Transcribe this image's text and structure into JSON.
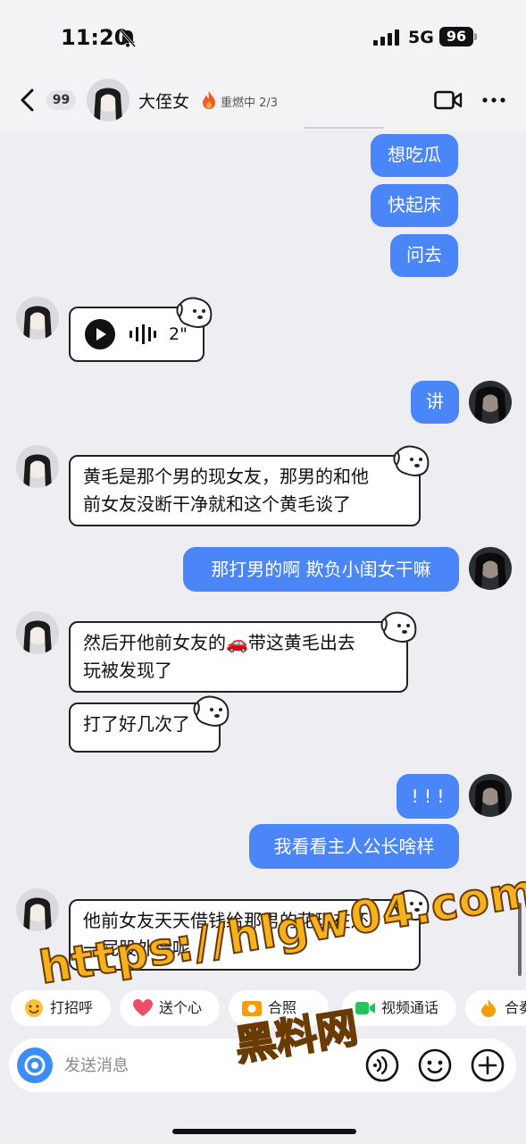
{
  "status_bar": {
    "time": "11:20",
    "network": "5G",
    "battery": "96"
  },
  "header": {
    "unread_count": "99",
    "contact_name": "大侄女",
    "streak_text": "重燃中 2/3"
  },
  "messages": [
    {
      "from": "me",
      "text": "想吃瓜"
    },
    {
      "from": "me",
      "text": "快起床"
    },
    {
      "from": "me",
      "text": "问去"
    },
    {
      "from": "them",
      "type": "voice",
      "duration": "2\""
    },
    {
      "from": "me",
      "text": "讲"
    },
    {
      "from": "them",
      "lines": [
        "黄毛是那个男的现女友，那男的和他",
        "前女友没断干净就和这个黄毛谈了"
      ]
    },
    {
      "from": "me",
      "text": "那打男的啊 欺负小闺女干嘛"
    },
    {
      "from": "them",
      "lines": [
        "然后开他前女友的🚗带这黄毛出去",
        "玩被发现了"
      ]
    },
    {
      "from": "them",
      "text": "打了好几次了"
    },
    {
      "from": "me",
      "text": "! ! !"
    },
    {
      "from": "me",
      "text": "我看看主人公长啥样"
    },
    {
      "from": "them",
      "lines": [
        "他前女友天天借钱给那男的花现在还",
        "一屁股外债呢"
      ]
    }
  ],
  "quick_actions": [
    {
      "label": "打招呼",
      "icon": "smile-emoji-icon"
    },
    {
      "label": "送个心",
      "icon": "heart-icon"
    },
    {
      "label": "合照",
      "icon": "photo-icon"
    },
    {
      "label": "视频通话",
      "icon": "video-call-icon",
      "icon_color": "#22c55e"
    },
    {
      "label": "合奏",
      "icon": "flame-icon"
    }
  ],
  "input": {
    "placeholder": "发送消息"
  },
  "watermark": {
    "url": "https://hlgw04.com",
    "site": "黑料网"
  },
  "colors": {
    "sent_bubble": "#4a86f7",
    "background": "#eeeef2",
    "watermark": "#f6b21d"
  }
}
